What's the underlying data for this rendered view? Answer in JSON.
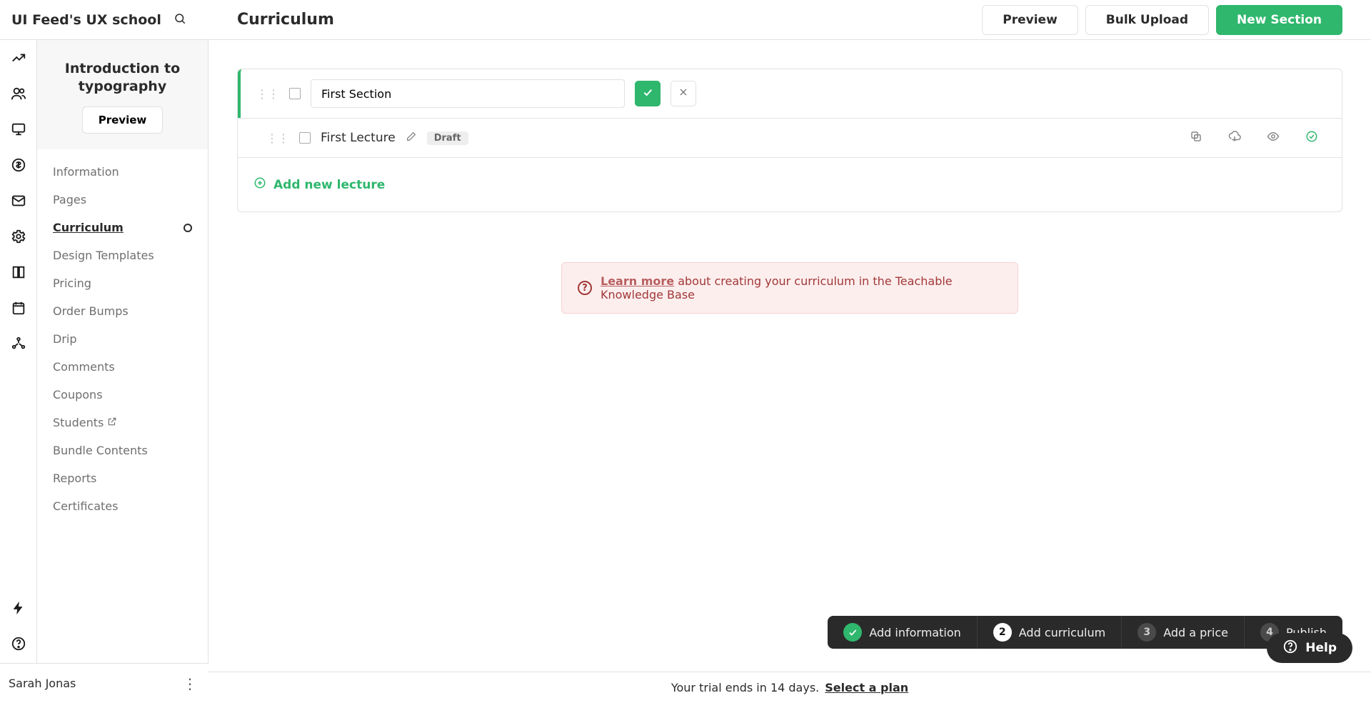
{
  "school_name": "UI Feed's UX school",
  "page_title": "Curriculum",
  "header_buttons": {
    "preview": "Preview",
    "bulk_upload": "Bulk Upload",
    "new_section": "New Section"
  },
  "course": {
    "title": "Introduction to typography",
    "preview_btn": "Preview"
  },
  "panel": {
    "items": [
      {
        "label": "Information"
      },
      {
        "label": "Pages"
      },
      {
        "label": "Curriculum",
        "active": true,
        "dot": true
      },
      {
        "label": "Design Templates"
      },
      {
        "label": "Pricing"
      },
      {
        "label": "Order Bumps"
      },
      {
        "label": "Drip"
      },
      {
        "label": "Comments"
      },
      {
        "label": "Coupons"
      },
      {
        "label": "Students",
        "ext": true
      },
      {
        "label": "Bundle Contents"
      },
      {
        "label": "Reports"
      },
      {
        "label": "Certificates"
      }
    ]
  },
  "section": {
    "name_value": "First Section",
    "lecture_title": "First Lecture",
    "draft_badge": "Draft",
    "add_lecture": "Add new lecture"
  },
  "banner": {
    "link": "Learn more",
    "text": " about creating your curriculum in the Teachable Knowledge Base"
  },
  "stepper": [
    {
      "num": "",
      "label": "Add information",
      "state": "done"
    },
    {
      "num": "2",
      "label": "Add curriculum",
      "state": "active"
    },
    {
      "num": "3",
      "label": "Add a price",
      "state": "muted"
    },
    {
      "num": "4",
      "label": "Publish",
      "state": "muted"
    }
  ],
  "trial": {
    "text": "Your trial ends in 14 days.",
    "link": "Select a plan"
  },
  "user": {
    "name": "Sarah Jonas"
  },
  "help": {
    "label": "Help"
  }
}
